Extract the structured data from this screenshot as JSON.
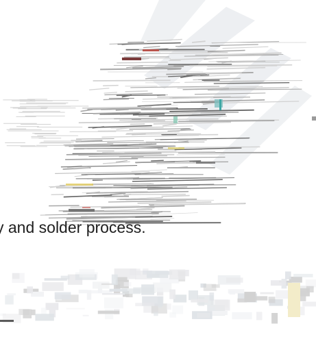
{
  "caption": {
    "text": "y and solder process."
  },
  "colors": {
    "background": "#ffffff",
    "stroke_dark": "#6a6a6a",
    "stroke_mid": "#a8a8a8",
    "stroke_light": "#d2d2d2",
    "fade_gray": "#e9e9ec",
    "accent_teal": "#3fa7a4",
    "accent_red": "#c7504a",
    "accent_yellow": "#e0c64a",
    "text": "#1e1e1e"
  }
}
